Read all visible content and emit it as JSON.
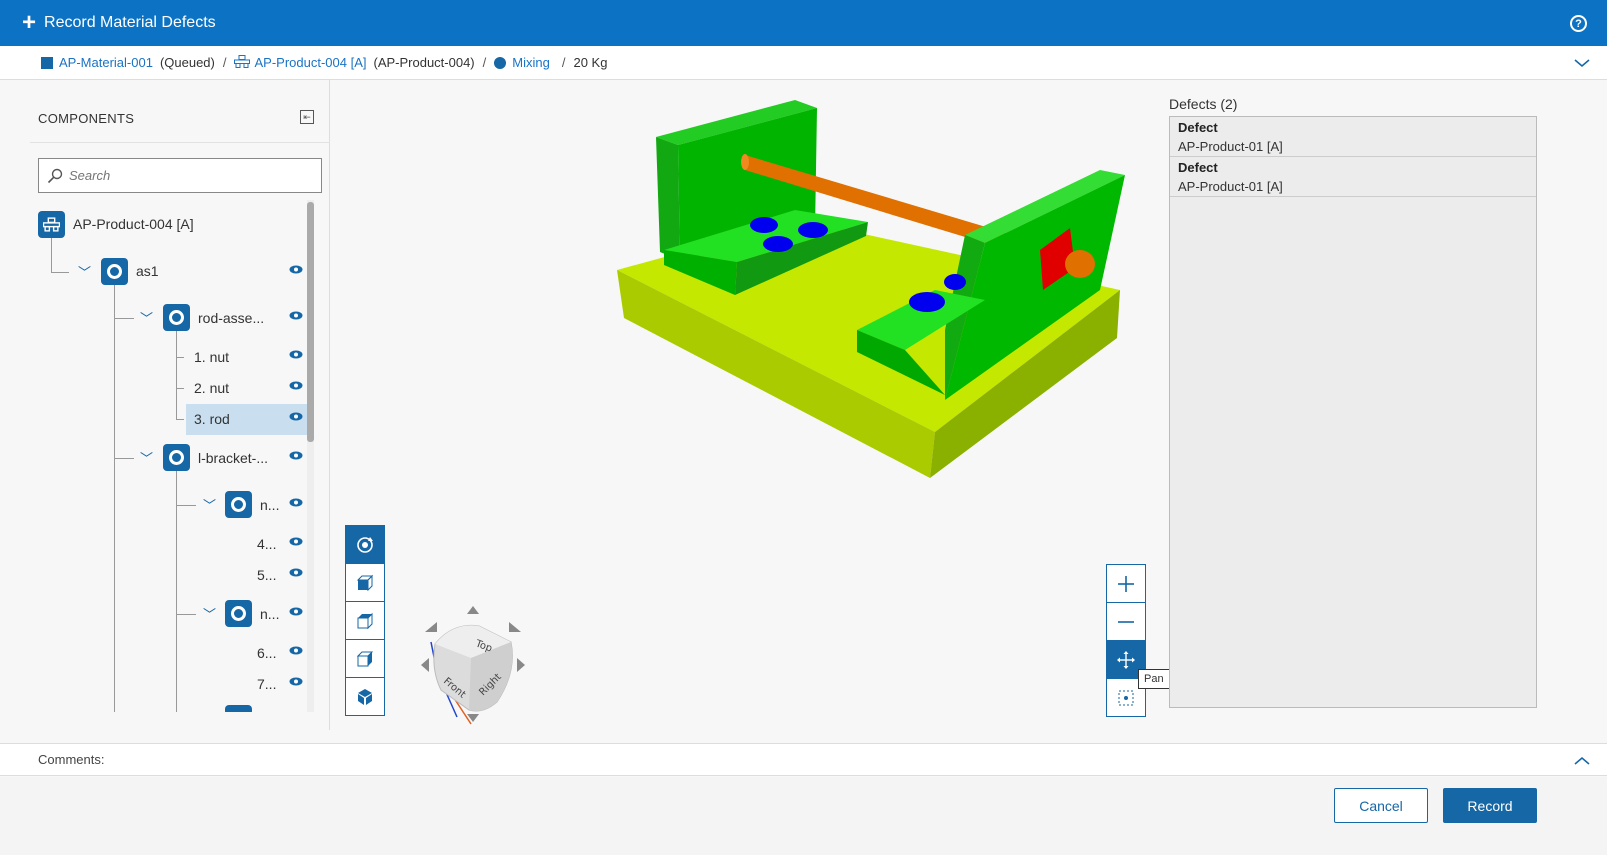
{
  "titlebar": {
    "title": "Record Material Defects",
    "help_icon": "help-icon"
  },
  "breadcrumb": {
    "material": "AP-Material-001",
    "material_status": "(Queued)",
    "product": "AP-Product-004 [A]",
    "product_id": "(AP-Product-004)",
    "operation": "Mixing",
    "quantity": "20 Kg",
    "separator": "/"
  },
  "components": {
    "heading": "COMPONENTS",
    "search_placeholder": "Search",
    "tree": {
      "root": "AP-Product-004 [A]",
      "as1": "as1",
      "rod_assembly": "rod-asse...",
      "nut1": "1. nut",
      "nut2": "2. nut",
      "rod3": "3. rod",
      "lbracket": "l-bracket-...",
      "n_a": "n...",
      "item4": "4...",
      "item5": "5...",
      "n_b": "n...",
      "item6": "6...",
      "item7": "7..."
    }
  },
  "viewer": {
    "tooltip": "Pan",
    "cube": {
      "top": "Top",
      "front": "Front",
      "right": "Right"
    }
  },
  "defects": {
    "header": "Defects (2)",
    "items": [
      {
        "title": "Defect",
        "subtitle": "AP-Product-01 [A]"
      },
      {
        "title": "Defect",
        "subtitle": "AP-Product-01 [A]"
      }
    ]
  },
  "comments": {
    "label": "Comments:"
  },
  "footer": {
    "cancel": "Cancel",
    "record": "Record"
  },
  "colors": {
    "brand": "#0c72c4",
    "accent": "#1567a6",
    "selected_row": "#c9dff0"
  }
}
